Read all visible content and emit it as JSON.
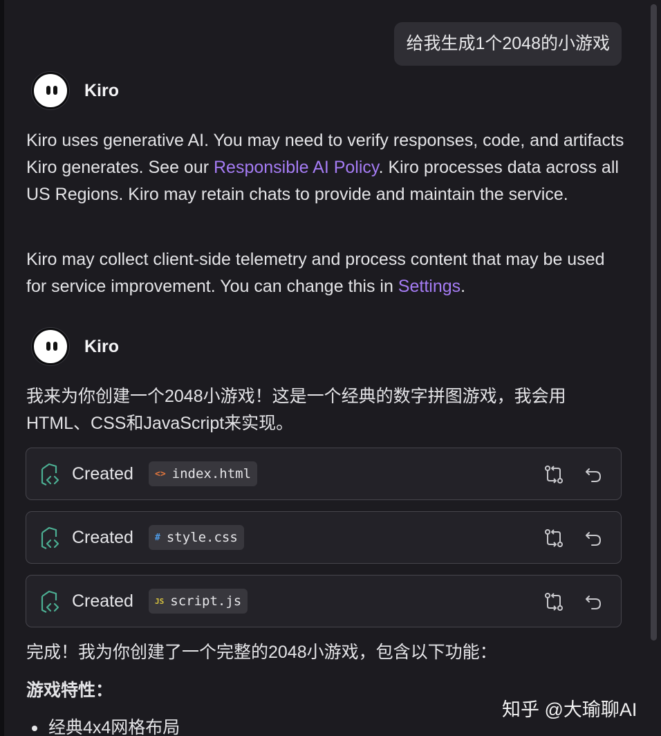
{
  "user_message": "给我生成1个2048的小游戏",
  "agent_name": "Kiro",
  "disclaimer": {
    "p1_before": "Kiro uses generative AI. You may need to verify responses, code, and artifacts Kiro generates. See our ",
    "p1_link": "Responsible AI Policy",
    "p1_after": ". Kiro processes data across all US Regions. Kiro may retain chats to provide and maintain the service.",
    "p2_before": "Kiro may collect client-side telemetry and process content that may be used for service improvement. You can change this in ",
    "p2_link": "Settings",
    "p2_after": "."
  },
  "response": {
    "intro": "我来为你创建一个2048小游戏！这是一个经典的数字拼图游戏，我会用HTML、CSS和JavaScript来实现。",
    "files": [
      {
        "action": "Created",
        "type_glyph": "<>",
        "name": "index.html",
        "icon": "html-file-icon"
      },
      {
        "action": "Created",
        "type_glyph": "#",
        "name": "style.css",
        "icon": "css-file-icon"
      },
      {
        "action": "Created",
        "type_glyph": "JS",
        "name": "script.js",
        "icon": "js-file-icon"
      }
    ],
    "done": "完成！我为你创建了一个完整的2048小游戏，包含以下功能：",
    "features_heading": "游戏特性：",
    "features": [
      "经典4x4网格布局"
    ]
  },
  "watermark": "知乎 @大瑜聊AI",
  "colors": {
    "background": "#1c1b20",
    "link": "#a57cf4",
    "icon_green": "#4caf93",
    "card_border": "#46454c"
  }
}
